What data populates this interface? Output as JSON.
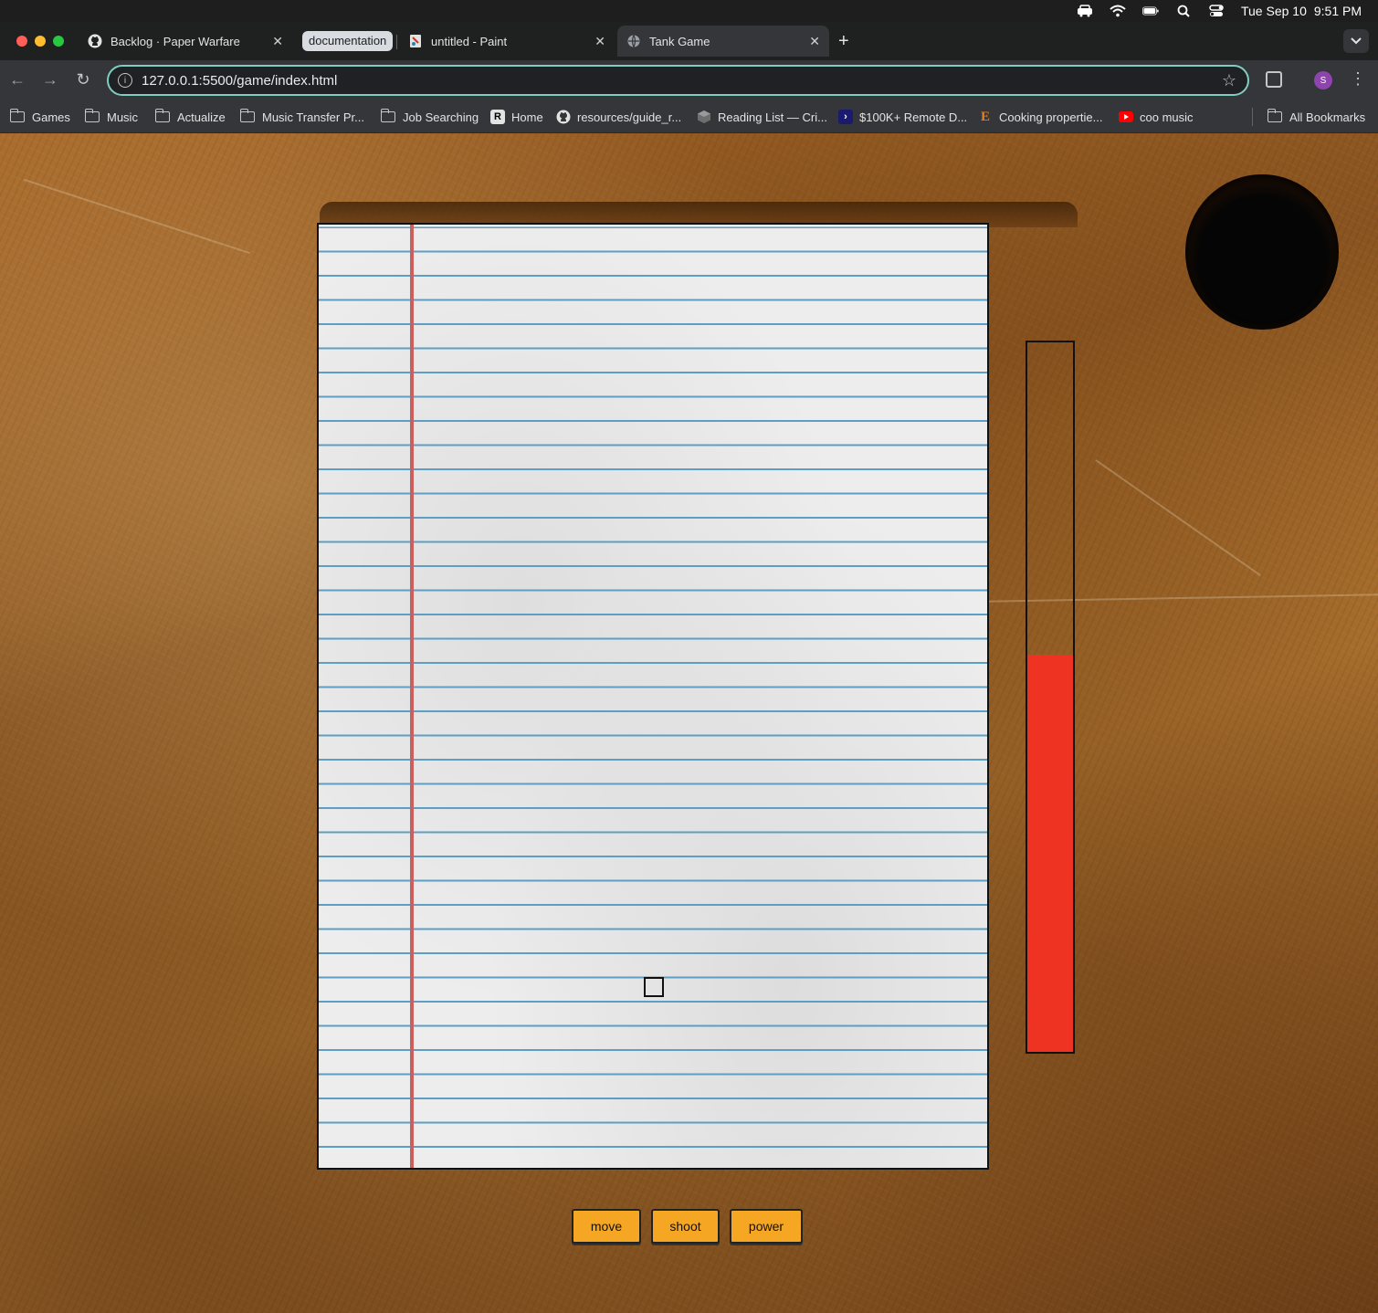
{
  "menubar": {
    "date": "Tue Sep 10",
    "time": "9:51 PM"
  },
  "tabs": [
    {
      "title": "Backlog · Paper Warfare",
      "icon": "github-icon",
      "active": false
    },
    {
      "group": "documentation"
    },
    {
      "title": "untitled - Paint",
      "icon": "paint-icon",
      "active": false
    },
    {
      "title": "Tank Game",
      "icon": "globe-icon",
      "active": true
    }
  ],
  "toolbar": {
    "url": "127.0.0.1:5500/game/index.html",
    "profile_initial": "S"
  },
  "bookmarks": [
    {
      "label": "Games",
      "icon": "folder-icon"
    },
    {
      "label": "Music",
      "icon": "folder-icon"
    },
    {
      "label": "Actualize",
      "icon": "folder-icon"
    },
    {
      "label": "Music Transfer Pr...",
      "icon": "folder-icon"
    },
    {
      "label": "Job Searching",
      "icon": "folder-icon"
    },
    {
      "label": "Home",
      "icon": "r-logo-icon"
    },
    {
      "label": "resources/guide_r...",
      "icon": "github-icon"
    },
    {
      "label": "Reading List — Cri...",
      "icon": "cube-icon"
    },
    {
      "label": "$100K+ Remote D...",
      "icon": "arrow-logo-icon"
    },
    {
      "label": "Cooking propertie...",
      "icon": "e-logo-icon"
    },
    {
      "label": "coo music",
      "icon": "youtube-icon"
    },
    {
      "label": "All Bookmarks",
      "icon": "folder-icon"
    }
  ],
  "game": {
    "power_level": 0.56,
    "power_color": "#ee3322",
    "buttons": {
      "move": "move",
      "shoot": "shoot",
      "power": "power"
    },
    "button_color": "#f5a623"
  }
}
